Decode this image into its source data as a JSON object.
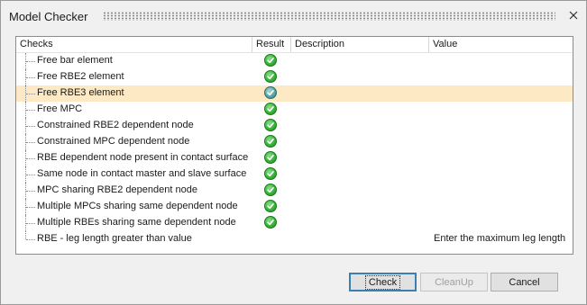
{
  "window": {
    "title": "Model Checker"
  },
  "columns": {
    "checks": "Checks",
    "result": "Result",
    "description": "Description",
    "value": "Value"
  },
  "rows": [
    {
      "label": "Free bar element",
      "result": "check-icon",
      "selected": false,
      "value": ""
    },
    {
      "label": "Free RBE2 element",
      "result": "check-icon",
      "selected": false,
      "value": ""
    },
    {
      "label": "Free RBE3 element",
      "result": "check-icon",
      "selected": true,
      "value": ""
    },
    {
      "label": "Free MPC",
      "result": "check-icon",
      "selected": false,
      "value": ""
    },
    {
      "label": "Constrained RBE2 dependent node",
      "result": "check-icon",
      "selected": false,
      "value": ""
    },
    {
      "label": "Constrained MPC dependent node",
      "result": "check-icon",
      "selected": false,
      "value": ""
    },
    {
      "label": "RBE dependent node present in contact surface",
      "result": "check-icon",
      "selected": false,
      "value": ""
    },
    {
      "label": "Same node in contact master and slave surface",
      "result": "check-icon",
      "selected": false,
      "value": ""
    },
    {
      "label": "MPC sharing RBE2 dependent node",
      "result": "check-icon",
      "selected": false,
      "value": ""
    },
    {
      "label": "Multiple MPCs sharing same dependent node",
      "result": "check-icon",
      "selected": false,
      "value": ""
    },
    {
      "label": "Multiple RBEs sharing same dependent node",
      "result": "check-icon",
      "selected": false,
      "value": ""
    },
    {
      "label": "RBE - leg length greater than value",
      "result": "",
      "selected": false,
      "value": "Enter the maximum leg length"
    }
  ],
  "buttons": {
    "check": "Check",
    "cleanup": "CleanUp",
    "cancel": "Cancel"
  },
  "colors": {
    "selected_row": "#fde9c3",
    "check_green": "#39b439"
  }
}
